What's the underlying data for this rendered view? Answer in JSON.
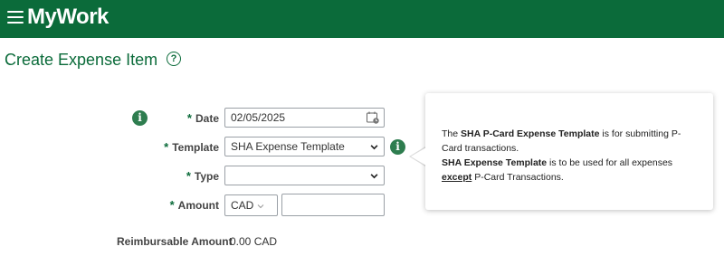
{
  "header": {
    "app_name": "MyWork",
    "menu_icon": "hamburger-menu-icon",
    "bg_color": "#0b6b3a"
  },
  "page": {
    "title": "Create Expense Item",
    "help_icon": "help-circle-icon",
    "help_glyph": "?"
  },
  "form": {
    "info_glyph": "i",
    "date": {
      "label": "Date",
      "required_mark": "*",
      "value": "02/05/2025",
      "icon": "calendar-icon"
    },
    "template": {
      "label": "Template",
      "required_mark": "*",
      "selected": "SHA Expense Template"
    },
    "type": {
      "label": "Type",
      "required_mark": "*",
      "selected": ""
    },
    "amount": {
      "label": "Amount",
      "required_mark": "*",
      "currency": "CAD",
      "value": ""
    },
    "reimbursable": {
      "label": "Reimbursable Amount",
      "value": "0.00 CAD"
    }
  },
  "popup": {
    "intro": "The ",
    "template1": "SHA P-Card Expense Template",
    "mid1": " is for submitting P-Card transactions.",
    "template2": "SHA Expense Template",
    "mid2": " is to be used for all expenses ",
    "emphasis": "except",
    "end": " P-Card Transactions."
  }
}
